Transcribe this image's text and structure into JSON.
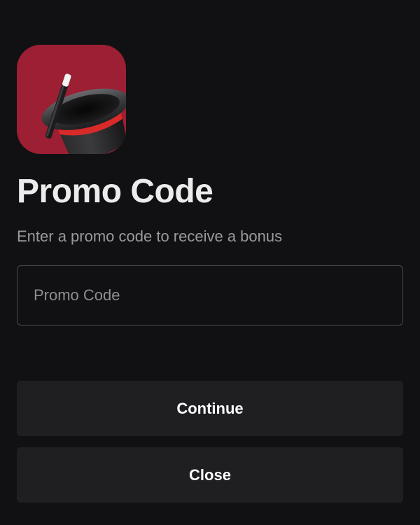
{
  "app_icon": {
    "icon": "magic-hat-wand-icon",
    "background_color": "#9c1f33"
  },
  "header": {
    "title": "Promo Code",
    "subtitle": "Enter a promo code to receive a bonus"
  },
  "promo_input": {
    "value": "",
    "placeholder": "Promo Code"
  },
  "buttons": {
    "continue_label": "Continue",
    "close_label": "Close"
  },
  "colors": {
    "background": "#111113",
    "button_background": "#1f1f22",
    "input_border": "#4a4a4e",
    "hat_band": "#d92a2a"
  }
}
